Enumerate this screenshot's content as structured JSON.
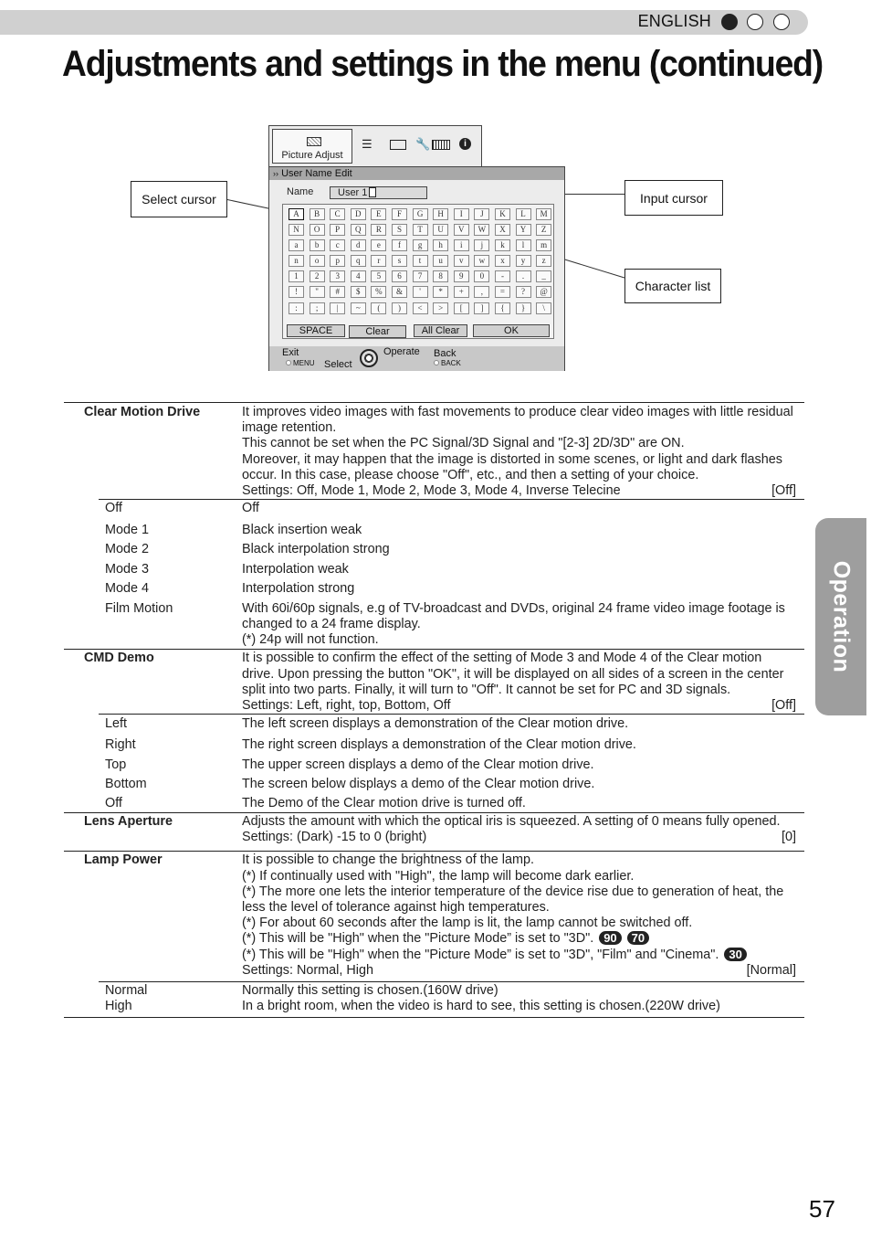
{
  "header": {
    "language": "ENGLISH",
    "title": "Adjustments and settings in the menu (continued)"
  },
  "figure": {
    "callouts": {
      "select_cursor": "Select cursor",
      "input_cursor": "Input cursor",
      "character_list": "Character list"
    },
    "menu": {
      "active_tab": "Picture Adjust",
      "tab_icons": [
        "picture-adjust-icon",
        "input-signal-icon",
        "installation-icon",
        "display-setup-icon",
        "function-icon",
        "information-icon"
      ],
      "breadcrumb": "User Name Edit",
      "name_label": "Name",
      "name_value": "User 1",
      "characters": [
        [
          "A",
          "B",
          "C",
          "D",
          "E",
          "F",
          "G",
          "H",
          "I",
          "J",
          "K",
          "L",
          "M"
        ],
        [
          "N",
          "O",
          "P",
          "Q",
          "R",
          "S",
          "T",
          "U",
          "V",
          "W",
          "X",
          "Y",
          "Z"
        ],
        [
          "a",
          "b",
          "c",
          "d",
          "e",
          "f",
          "g",
          "h",
          "i",
          "j",
          "k",
          "l",
          "m"
        ],
        [
          "n",
          "o",
          "p",
          "q",
          "r",
          "s",
          "t",
          "u",
          "v",
          "w",
          "x",
          "y",
          "z"
        ],
        [
          "1",
          "2",
          "3",
          "4",
          "5",
          "6",
          "7",
          "8",
          "9",
          "0",
          "-",
          ".",
          "_"
        ],
        [
          "!",
          "\"",
          "#",
          "$",
          "%",
          "&",
          "'",
          "*",
          "+",
          "",
          ",",
          "=",
          "?",
          "@"
        ],
        [
          ":",
          ";",
          "|",
          "~",
          "(",
          ")",
          "<",
          ">",
          "[",
          "]",
          "{",
          "}",
          "\\"
        ]
      ],
      "buttons": {
        "space": "SPACE",
        "clear": "Clear",
        "all_clear": "All Clear",
        "ok": "OK"
      },
      "footer": {
        "exit": "Exit",
        "menu_key": "MENU",
        "select": "Select",
        "operate": "Operate",
        "back": "Back",
        "back_key": "BACK"
      }
    }
  },
  "table": [
    {
      "term": "Clear Motion Drive",
      "desc": [
        "It improves video images with fast movements to produce clear video images with little residual image retention.",
        "This cannot be set when the PC Signal/3D Signal and \"[2-3] 2D/3D\" are ON.",
        "Moreover, it may happen that the image is distorted in some scenes, or light and dark flashes occur. In this case, please choose \"Off\", etc., and then a setting of your choice."
      ],
      "settings": "Settings: Off, Mode 1, Mode 2, Mode 3, Mode 4, Inverse Telecine",
      "default": "[Off]",
      "options": [
        {
          "term": "Off",
          "desc": "Off"
        },
        {
          "term": "Mode 1",
          "desc": "Black insertion weak"
        },
        {
          "term": "Mode 2",
          "desc": "Black interpolation strong"
        },
        {
          "term": "Mode 3",
          "desc": "Interpolation weak"
        },
        {
          "term": "Mode 4",
          "desc": "Interpolation strong"
        },
        {
          "term": "Film Motion",
          "desc": "With 60i/60p signals, e.g of TV-broadcast and DVDs, original 24 frame video image footage is changed to a 24 frame display.",
          "note": "(*) 24p will not function."
        }
      ]
    },
    {
      "term": "CMD Demo",
      "desc": [
        "It is possible to confirm the effect of the setting of Mode 3 and Mode 4 of the Clear motion drive. Upon pressing the button \"OK\", it will be displayed on all sides of a screen in the center split into two parts. Finally, it will turn to \"Off\". It cannot be set for PC and 3D signals."
      ],
      "settings": "Settings: Left, right, top, Bottom, Off",
      "default": "[Off]",
      "options": [
        {
          "term": "Left",
          "desc": "The left screen displays a demonstration of the Clear motion drive."
        },
        {
          "term": "Right",
          "desc": "The right screen displays a demonstration of the Clear motion drive."
        },
        {
          "term": "Top",
          "desc": "The upper screen displays a demo of the Clear motion drive."
        },
        {
          "term": "Bottom",
          "desc": "The screen below displays a demo of the Clear motion drive."
        },
        {
          "term": "Off",
          "desc": "The Demo of the Clear motion drive is turned off."
        }
      ]
    },
    {
      "term": "Lens Aperture",
      "desc": [
        "Adjusts the amount with which the optical iris is squeezed. A setting of 0 means fully opened."
      ],
      "settings": "Settings: (Dark) -15 to 0 (bright)",
      "default": "[0]",
      "options": []
    },
    {
      "term": "Lamp Power",
      "desc": [
        "It is possible to change the brightness of the lamp.",
        "(*) If continually used with \"High\", the lamp will become dark earlier.",
        "(*) The more one lets the interior temperature of the device rise due to generation of heat, the less the level of tolerance against high temperatures.",
        "(*) For about 60 seconds after the lamp is lit, the lamp cannot be switched off."
      ],
      "badge_lines": [
        {
          "text": "(*) This will be \"High\" when the \"Picture Mode” is set to \"3D\".",
          "badges": [
            "90",
            "70"
          ]
        },
        {
          "text": "(*) This will be \"High\" when the \"Picture Mode” is set to \"3D\", \"Film\" and \"Cinema\".",
          "badges": [
            "30"
          ]
        }
      ],
      "settings": "Settings: Normal, High",
      "default": "[Normal]",
      "options_combined": {
        "terms": [
          "Normal",
          "High"
        ],
        "descs": [
          "Normally this setting is chosen.(160W drive)",
          "In a bright room, when the video is hard to see, this setting is chosen.(220W drive)"
        ]
      }
    }
  ],
  "side_tab": "Operation",
  "page_number": "57"
}
